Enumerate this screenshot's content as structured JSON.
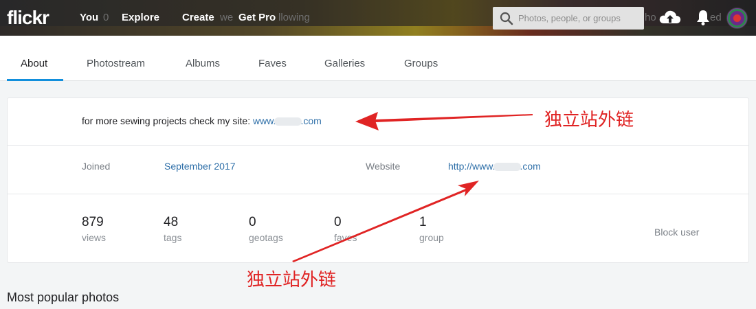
{
  "header": {
    "logo": "flickr",
    "nav": [
      "You",
      "Explore",
      "Create",
      "Get Pro"
    ],
    "search_placeholder": "Photos, people, or groups",
    "cover_text_left": "0",
    "cover_text_mid": "we",
    "cover_text_following": "llowing",
    "cover_text_right": "ho",
    "cover_text_far": "ed"
  },
  "tabs": [
    "About",
    "Photostream",
    "Albums",
    "Faves",
    "Galleries",
    "Groups"
  ],
  "about": {
    "description_prefix": "for more sewing projects check my site: ",
    "description_link_start": "www.",
    "description_link_end": ".com",
    "joined_label": "Joined",
    "joined_value": "September 2017",
    "website_label": "Website",
    "website_link_start": "http://www.",
    "website_link_end": ".com"
  },
  "stats": [
    {
      "num": "879",
      "label": "views"
    },
    {
      "num": "48",
      "label": "tags"
    },
    {
      "num": "0",
      "label": "geotags"
    },
    {
      "num": "0",
      "label": "faves"
    },
    {
      "num": "1",
      "label": "group"
    }
  ],
  "block_user": "Block user",
  "section_heading": "Most popular photos",
  "annotations": [
    "独立站外链",
    "独立站外链"
  ],
  "colors": {
    "accent": "#128fdc",
    "link": "#2e6fa8",
    "annotation": "#e02424",
    "header_bg": "#212124"
  }
}
